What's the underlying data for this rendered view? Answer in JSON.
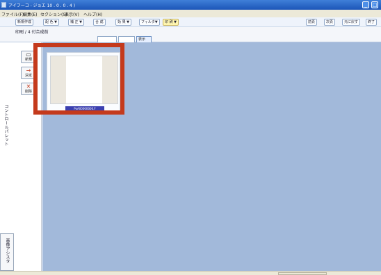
{
  "window": {
    "title": "アイフーコ - ジョエ 10 . 0 . 0 . 4 )",
    "controls": [
      "minimize-icon",
      "maximize-icon"
    ]
  },
  "menubar": {
    "items": [
      "ファイル(F)",
      "編集(E)",
      "セクション(S)",
      "表示(V)",
      "ヘルプ(H)"
    ]
  },
  "toolbar": {
    "left_buttons": [
      "新規作成",
      "配 色 ▼",
      "補 正 ▼",
      "合 成",
      "効 果 ▼",
      "フィルタ▼",
      "印 刷 ▼"
    ],
    "right_buttons": [
      "前頁",
      "次頁",
      "元に戻す",
      "終了"
    ]
  },
  "tabs": {
    "current_label": "印刷 / 4 付合成前",
    "items": [
      "",
      "",
      "表示"
    ]
  },
  "left_palette": {
    "buttons": [
      {
        "icon": "new-icon",
        "label": "新規"
      },
      {
        "icon": "arrow-right-icon",
        "label": "決定"
      },
      {
        "icon": "delete-x-icon",
        "label": "削除"
      }
    ],
    "vertical_label": "コントロールパレット",
    "bottom_label": "画像アシスタ"
  },
  "main": {
    "thumbnail_caption": "PoA00000000.F"
  },
  "colors": {
    "workspace": "#a2b9da",
    "highlight": "#c43a1c",
    "caption_bg": "#3b40b0",
    "titlebar": "#1c55b8"
  }
}
